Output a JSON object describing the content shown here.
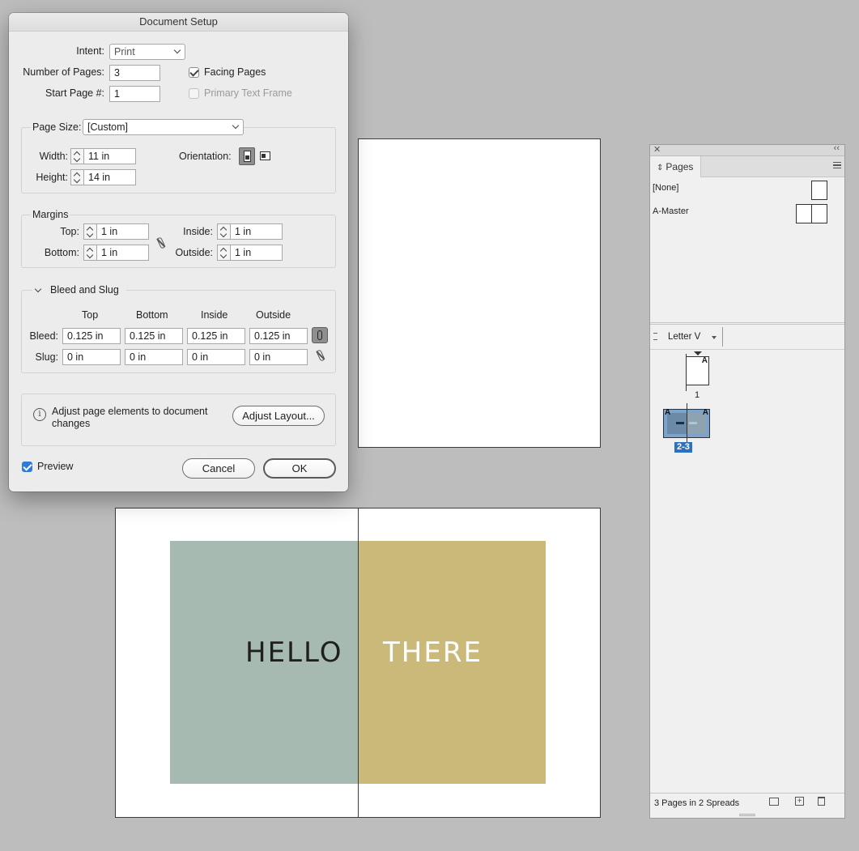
{
  "dialog": {
    "title": "Document Setup",
    "intent_label": "Intent:",
    "intent_value": "Print",
    "num_pages_label": "Number of Pages:",
    "num_pages_value": "3",
    "start_page_label": "Start Page #:",
    "start_page_value": "1",
    "facing_pages_label": "Facing Pages",
    "facing_pages_checked": true,
    "primary_text_frame_label": "Primary Text Frame",
    "page_size_label": "Page Size:",
    "page_size_value": "[Custom]",
    "width_label": "Width:",
    "width_value": "11 in",
    "height_label": "Height:",
    "height_value": "14 in",
    "orientation_label": "Orientation:",
    "margins": {
      "title": "Margins",
      "top_label": "Top:",
      "top_value": "1 in",
      "bottom_label": "Bottom:",
      "bottom_value": "1 in",
      "inside_label": "Inside:",
      "inside_value": "1 in",
      "outside_label": "Outside:",
      "outside_value": "1 in"
    },
    "bleed_slug": {
      "title": "Bleed and Slug",
      "columns": [
        "Top",
        "Bottom",
        "Inside",
        "Outside"
      ],
      "bleed_label": "Bleed:",
      "bleed_values": [
        "0.125 in",
        "0.125 in",
        "0.125 in",
        "0.125 in"
      ],
      "slug_label": "Slug:",
      "slug_values": [
        "0 in",
        "0 in",
        "0 in",
        "0 in"
      ]
    },
    "adjust_text": "Adjust page elements to document changes",
    "adjust_button": "Adjust Layout...",
    "preview_label": "Preview",
    "preview_checked": true,
    "cancel_button": "Cancel",
    "ok_button": "OK"
  },
  "spread": {
    "left_word": "HELLO",
    "right_word": "THERE",
    "left_color": "#a6bab2",
    "right_color": "#cab978"
  },
  "pages_panel": {
    "tab_label": "Pages",
    "masters": [
      {
        "name": "[None]"
      },
      {
        "name": "A-Master"
      }
    ],
    "view_label": "Letter V",
    "page1_label": "1",
    "spread_label": "2-3",
    "master_prefix": "A",
    "status": "3 Pages in 2 Spreads"
  }
}
